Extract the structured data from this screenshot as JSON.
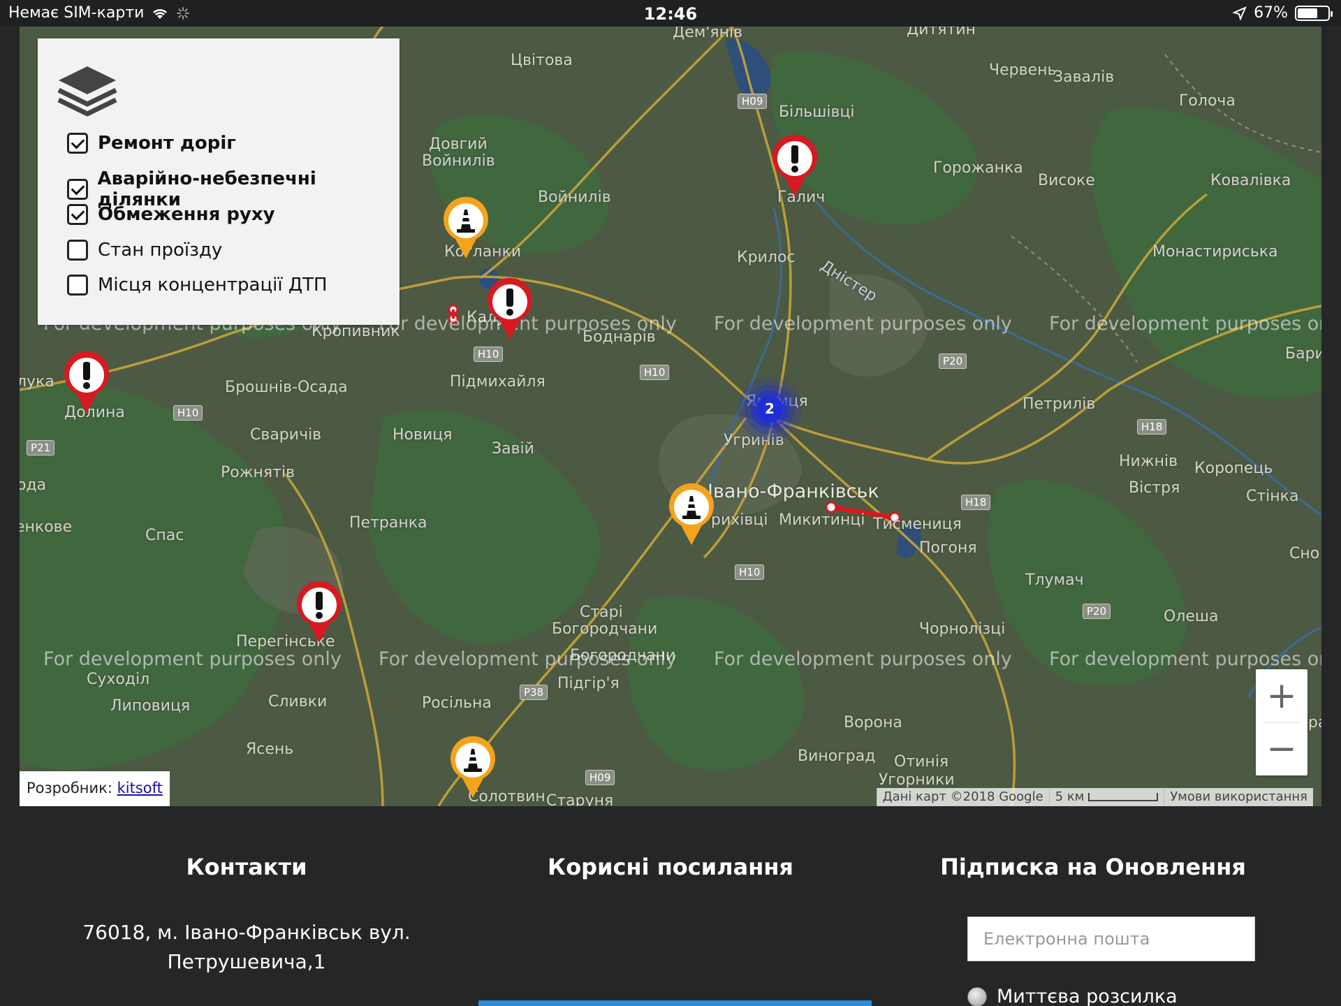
{
  "status_bar": {
    "carrier": "Немає SIM-карти",
    "time": "12:46",
    "battery": "67%",
    "battery_level": 0.67
  },
  "layers": {
    "items": [
      {
        "label": "Ремонт доріг",
        "checked": true
      },
      {
        "label": "Аварійно-небезпечні ділянки",
        "checked": true
      },
      {
        "label": "Обмеження руху",
        "checked": true
      },
      {
        "label": "Стан проїзду",
        "checked": false
      },
      {
        "label": "Місця концентрації ДТП",
        "checked": false
      }
    ]
  },
  "map": {
    "places": {
      "demianiv": "Дем'янів",
      "dytiatyn": "Дитятин",
      "tsvitova": "Цвітова",
      "chervin": "Червень",
      "zavaliv": "Завалів",
      "golocha": "Голоча",
      "bilshivtsi": "Більшівці",
      "dovhyi": "Довгий",
      "voinyliv1": "Войнилів",
      "horozhanka": "Горожанка",
      "vysoke": "Високе",
      "kovalivka": "Ковалівка",
      "voinyliv2": "Войнилів",
      "halych": "Галич",
      "koropets_left": "Ка",
      "kolanky": "Когланки",
      "krylos": "Крилос",
      "dnister": "Дністер",
      "monastyryska": "Монастириська",
      "kalush": "Калуш",
      "kropyvnyk": "Кропивник",
      "bodnariv": "Боднарів",
      "baryshivka": "Бари",
      "luka": "лука",
      "pidmykhailia": "Підмихайля",
      "broshniv": "Брошнів-Осада",
      "petriliv": "Петрилів",
      "dolyna": "Долина",
      "yamnytsia": "Ямниця",
      "svarychiv": "Сваричів",
      "novytsia": "Новиця",
      "zaviy": "Завій",
      "uhryniv": "Угринів",
      "nyzhniv": "Нижнів",
      "koropets": "Коропець",
      "rozhniativ": "Рожнятів",
      "vistria": "Вістря",
      "stinka": "Стінка",
      "oda": "ода",
      "frankivsk": "Івано-Франківськ",
      "enkove": "енкове",
      "petranka": "Петранка",
      "khryvtsi": "рихівці",
      "mykytyntsi": "Микитинці",
      "tysmenytsia": "Тисмениця",
      "spas": "Спас",
      "pohonia": "Погоня",
      "sno": "Сно",
      "tlumach": "Тлумач",
      "peregynske": "Перегінське",
      "stari_bohorodchany": "Старі",
      "bohorodchany": "Богородчани",
      "olesha": "Олеша",
      "chornolitsi": "Чорнолізці",
      "bohorodchany2": "Богородчани",
      "sukhodil": "Суходіл",
      "pidhiria": "Підгір'я",
      "lypovytsia": "Липовиця",
      "slyvky": "Сливки",
      "rosilna": "Росільна",
      "vorona": "Ворона",
      "hara": "Гара",
      "yasen": "Ясень",
      "vynohrad": "Виноград",
      "otyniia": "Отинія",
      "uhornyky": "Угорники",
      "solotvyn": "Солотвин",
      "starunia": "Старуня"
    },
    "roads": {
      "h09a": "H09",
      "h10a": "H10",
      "h10b": "H10",
      "h10c": "H10",
      "p20a": "P20",
      "p21": "P21",
      "h18a": "H18",
      "h18b": "H18",
      "h10d": "H10",
      "p20b": "P20",
      "p38": "P38",
      "h09b": "H09"
    },
    "watermark": "For development purposes only",
    "cluster_count": "2",
    "zoom_in": "+",
    "zoom_out": "−",
    "developer_label": "Розробник:",
    "developer_link": "kitsoft",
    "map_data": "Дані карт ©2018 Google",
    "scale": "5 км",
    "terms": "Умови використання"
  },
  "footer": {
    "contacts_heading": "Контакти",
    "address_line1": "76018, м. Івано-Франківськ вул.",
    "address_line2": "Петрушевича,1",
    "links_heading": "Корисні посилання",
    "subscribe_heading": "Підписка на Оновлення",
    "email_placeholder": "Електронна пошта",
    "instant_label": "Миттєва розсилка"
  },
  "colors": {
    "danger": "#d71920",
    "roadwork": "#f5a31a",
    "cluster": "#1f2fd6",
    "footer_bg": "#252628"
  }
}
